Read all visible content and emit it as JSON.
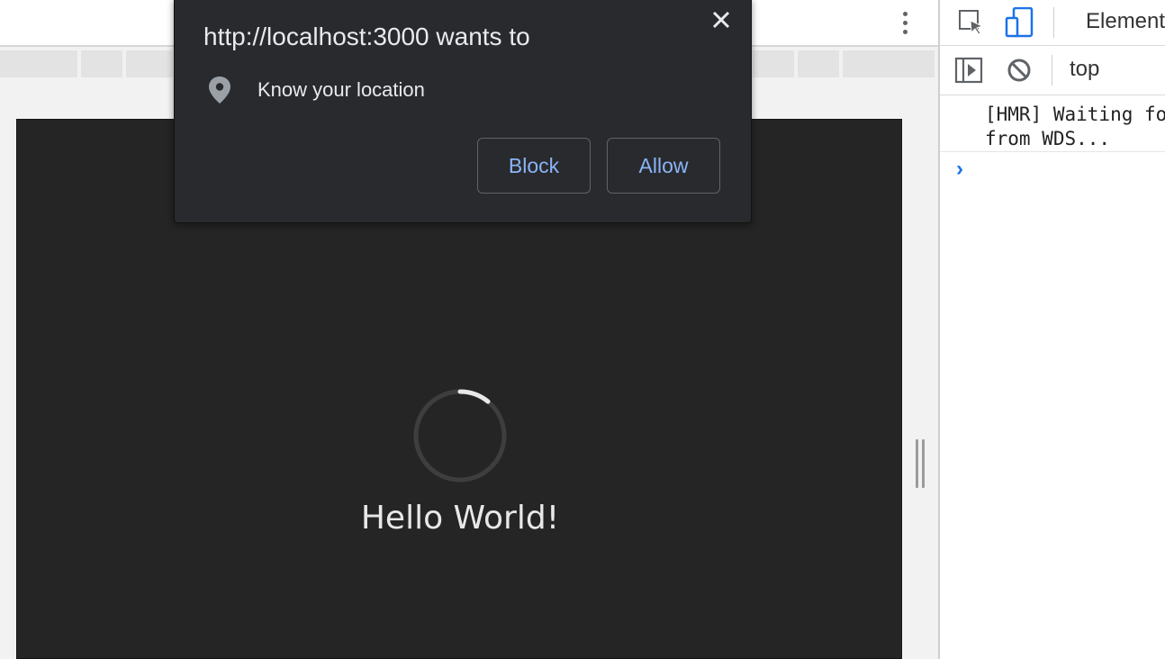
{
  "permission_prompt": {
    "origin_text": "http://localhost:3000 wants to",
    "permission_label": "Know your location",
    "block_label": "Block",
    "allow_label": "Allow",
    "close_icon": "close-icon",
    "location_icon": "location-pin-icon"
  },
  "app": {
    "heading": "Hello World!",
    "loading": "spinner"
  },
  "devtools": {
    "panel_tab": "Elements",
    "context": "top",
    "console_message": "[HMR] Waiting for\nfrom WDS...",
    "prompt_symbol": "›",
    "icons": [
      "inspect-icon",
      "device-toggle-icon",
      "sidebar-toggle-icon",
      "clear-console-icon"
    ]
  },
  "colors": {
    "dialog_bg": "#292a2d",
    "button_text": "#8ab4f8",
    "viewport_bg": "#252525",
    "devtools_accent": "#1a73e8"
  }
}
